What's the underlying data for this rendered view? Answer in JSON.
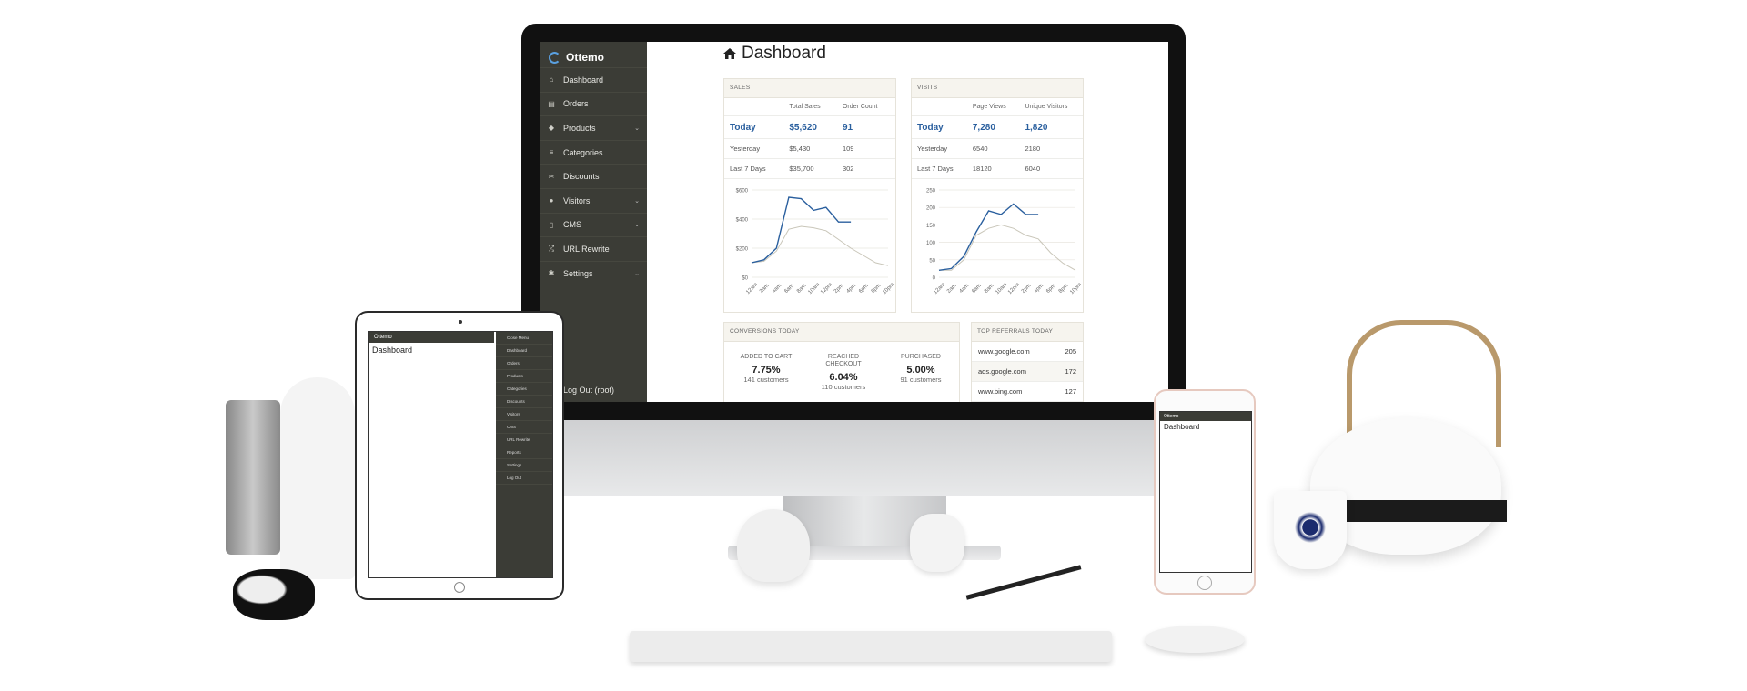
{
  "app": {
    "name": "Ottemo",
    "page_title": "Dashboard"
  },
  "sidebar": {
    "items": [
      {
        "label": "Dashboard",
        "icon": "home-icon",
        "glyph": "⌂",
        "has_chevron": false
      },
      {
        "label": "Orders",
        "icon": "orders-icon",
        "glyph": "▤",
        "has_chevron": false
      },
      {
        "label": "Products",
        "icon": "tag-icon",
        "glyph": "◆",
        "has_chevron": true
      },
      {
        "label": "Categories",
        "icon": "list-icon",
        "glyph": "≡",
        "has_chevron": false
      },
      {
        "label": "Discounts",
        "icon": "scissors-icon",
        "glyph": "✂",
        "has_chevron": false
      },
      {
        "label": "Visitors",
        "icon": "users-icon",
        "glyph": "●",
        "has_chevron": true
      },
      {
        "label": "CMS",
        "icon": "file-icon",
        "glyph": "▯",
        "has_chevron": true
      },
      {
        "label": "URL Rewrite",
        "icon": "shuffle-icon",
        "glyph": "⤮",
        "has_chevron": false
      },
      {
        "label": "Settings",
        "icon": "gear-icon",
        "glyph": "✱",
        "has_chevron": true
      }
    ],
    "logout": "Log Out (root)"
  },
  "sales": {
    "heading": "SALES",
    "col1": "Total Sales",
    "col2": "Order Count",
    "rows": [
      {
        "label": "Today",
        "a": "$5,620",
        "b": "91"
      },
      {
        "label": "Yesterday",
        "a": "$5,430",
        "b": "109"
      },
      {
        "label": "Last 7 Days",
        "a": "$35,700",
        "b": "302"
      }
    ]
  },
  "visits": {
    "heading": "VISITS",
    "col1": "Page Views",
    "col2": "Unique Visitors",
    "rows": [
      {
        "label": "Today",
        "a": "7,280",
        "b": "1,820"
      },
      {
        "label": "Yesterday",
        "a": "6540",
        "b": "2180"
      },
      {
        "label": "Last 7 Days",
        "a": "18120",
        "b": "6040"
      }
    ]
  },
  "conversions": {
    "heading": "CONVERSIONS TODAY",
    "items": [
      {
        "label": "ADDED TO CART",
        "value": "7.75%",
        "sub": "141 customers"
      },
      {
        "label": "REACHED CHECKOUT",
        "value": "6.04%",
        "sub": "110 customers"
      },
      {
        "label": "PURCHASED",
        "value": "5.00%",
        "sub": "91 customers"
      }
    ]
  },
  "referrals": {
    "heading": "TOP REFERRALS TODAY",
    "rows": [
      {
        "site": "www.google.com",
        "count": "205"
      },
      {
        "site": "ads.google.com",
        "count": "172"
      },
      {
        "site": "www.bing.com",
        "count": "127"
      }
    ]
  },
  "chart_data": [
    {
      "type": "line",
      "title": "",
      "x": [
        "12am",
        "2am",
        "4am",
        "6am",
        "8am",
        "10am",
        "12pm",
        "2pm",
        "4pm",
        "6pm",
        "8pm",
        "10pm"
      ],
      "yticks": [
        "$0",
        "$200",
        "$400",
        "$600"
      ],
      "ylim": [
        0,
        600
      ],
      "series": [
        {
          "values": [
            100,
            120,
            200,
            550,
            540,
            460,
            480,
            380,
            380,
            null,
            null,
            null
          ],
          "color": "#2a5f9e"
        },
        {
          "values": [
            100,
            110,
            180,
            330,
            350,
            340,
            320,
            260,
            200,
            150,
            100,
            80
          ],
          "color": "#c9c6b9"
        }
      ],
      "grid": true
    },
    {
      "type": "line",
      "title": "",
      "x": [
        "12am",
        "2am",
        "4am",
        "6am",
        "8am",
        "10am",
        "12pm",
        "2pm",
        "4pm",
        "6pm",
        "8pm",
        "10pm"
      ],
      "yticks": [
        "0",
        "50",
        "100",
        "150",
        "200",
        "250"
      ],
      "ylim": [
        0,
        250
      ],
      "series": [
        {
          "values": [
            20,
            25,
            60,
            130,
            190,
            180,
            210,
            180,
            180,
            null,
            null,
            null
          ],
          "color": "#2a5f9e"
        },
        {
          "values": [
            20,
            20,
            50,
            120,
            140,
            150,
            140,
            120,
            110,
            70,
            40,
            20
          ],
          "color": "#c9c6b9"
        }
      ],
      "grid": true
    }
  ],
  "ipad": {
    "brand": "Ottemo",
    "title": "Dashboard",
    "menu": [
      "Close Menu",
      "Dashboard",
      "Orders",
      "Products",
      "Categories",
      "Discounts",
      "Visitors",
      "CMS",
      "URL Rewrite",
      "Reports",
      "Settings",
      "Log Out"
    ]
  },
  "iphone": {
    "brand": "Ottemo",
    "title": "Dashboard"
  },
  "colors": {
    "sidebar": "#3b3c36",
    "accent": "#2a5f9e",
    "secondary_line": "#c9c6b9"
  }
}
